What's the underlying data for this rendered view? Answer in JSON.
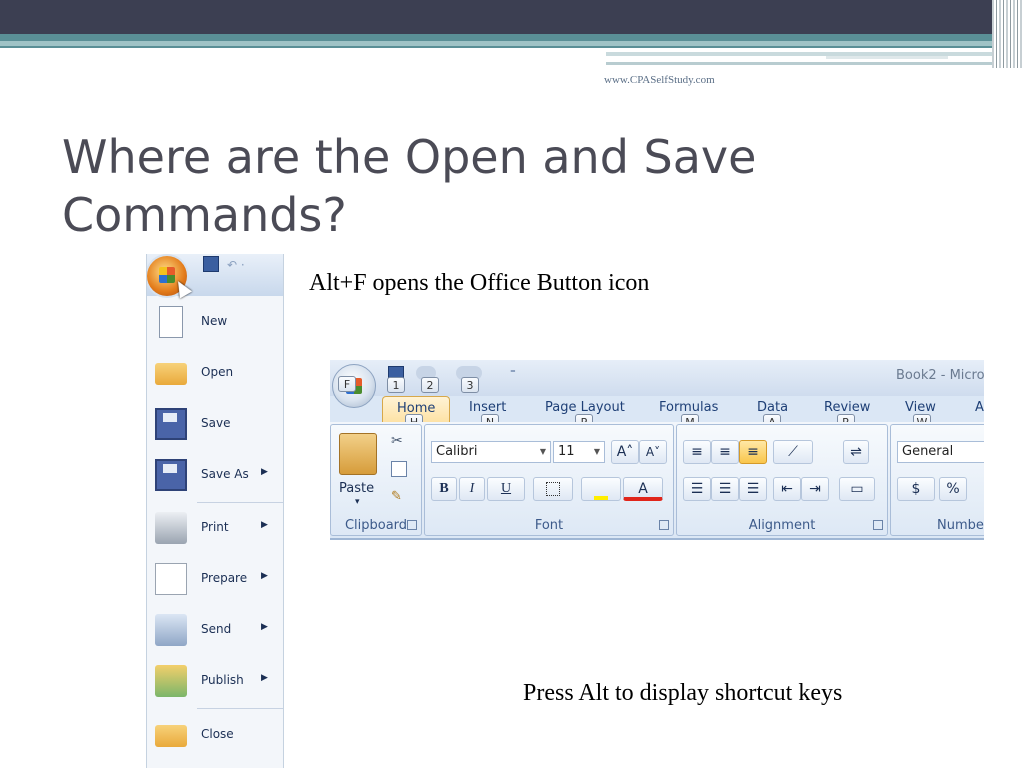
{
  "site_url": "www.CPASelfStudy.com",
  "slide_title": "Where are the Open and Save Commands?",
  "caption_office_button": "Alt+F opens the Office Button icon",
  "caption_shortcuts": "Press Alt to display shortcut keys",
  "office_menu": {
    "items": [
      {
        "label": "New",
        "icon": "new-document-icon",
        "submenu": false
      },
      {
        "label": "Open",
        "icon": "folder-open-icon",
        "submenu": false
      },
      {
        "label": "Save",
        "icon": "save-disk-icon",
        "submenu": false
      },
      {
        "label": "Save As",
        "icon": "save-as-icon",
        "submenu": true
      },
      {
        "label": "Print",
        "icon": "printer-icon",
        "submenu": true
      },
      {
        "label": "Prepare",
        "icon": "prepare-icon",
        "submenu": true
      },
      {
        "label": "Send",
        "icon": "send-icon",
        "submenu": true
      },
      {
        "label": "Publish",
        "icon": "publish-icon",
        "submenu": true
      },
      {
        "label": "Close",
        "icon": "close-folder-icon",
        "submenu": false
      }
    ],
    "arrow": "▶"
  },
  "ribbon": {
    "office_button_keytip": "F",
    "qat_keytips": [
      "1",
      "2",
      "3"
    ],
    "qat_more": "⁼",
    "document_title": "Book2 - Micro",
    "tabs": [
      {
        "label": "Home",
        "keytip": "H"
      },
      {
        "label": "Insert",
        "keytip": "N"
      },
      {
        "label": "Page Layout",
        "keytip": "P"
      },
      {
        "label": "Formulas",
        "keytip": "M"
      },
      {
        "label": "Data",
        "keytip": "A"
      },
      {
        "label": "Review",
        "keytip": "R"
      },
      {
        "label": "View",
        "keytip": "W"
      },
      {
        "label": "A",
        "keytip": ""
      }
    ],
    "groups": {
      "clipboard": {
        "label": "Clipboard",
        "paste_label": "Paste",
        "paste_arrow": "▾"
      },
      "font": {
        "label": "Font",
        "font_name": "Calibri",
        "font_size": "11",
        "grow": "A˄",
        "shrink": "A˅",
        "bold": "B",
        "italic": "I",
        "underline": "U",
        "font_color_letter": "A"
      },
      "alignment": {
        "label": "Alignment"
      },
      "number": {
        "label": "Numbe",
        "format": "General",
        "currency": "$",
        "percent": "%"
      }
    }
  },
  "colors": {
    "top_bar": "#3c3f52",
    "teal_band": "#5a8f96",
    "title_text": "#4b4b56",
    "active_tab": "#fde2a6"
  }
}
